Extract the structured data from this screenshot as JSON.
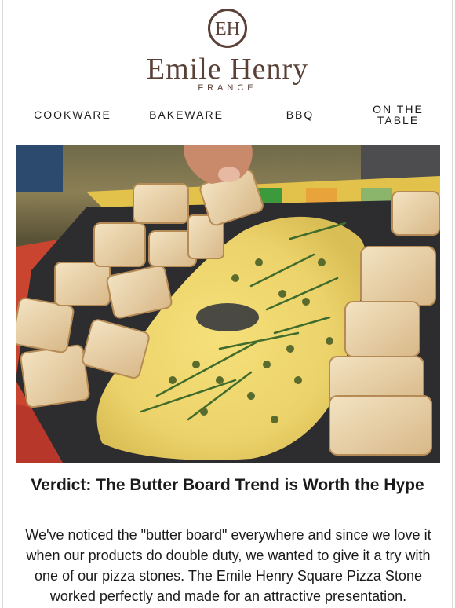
{
  "brand": {
    "monogram": "EH",
    "name": "Emile Henry",
    "country": "FRANCE",
    "colors": {
      "brand": "#5a4037"
    }
  },
  "nav": {
    "items": [
      {
        "label": "COOKWARE"
      },
      {
        "label": "BAKEWARE"
      },
      {
        "label": "BBQ"
      },
      {
        "label_line1": "ON THE",
        "label_line2": "TABLE"
      }
    ]
  },
  "hero": {
    "image": "butter-board-photo"
  },
  "article": {
    "headline": "Verdict: The Butter Board Trend is Worth the Hype",
    "body": "We've noticed the \"butter board\" everywhere and since we love it when our products do double duty, we wanted to give it a try with one of our pizza stones. The Emile Henry Square Pizza Stone worked perfectly and made for an attractive presentation."
  }
}
